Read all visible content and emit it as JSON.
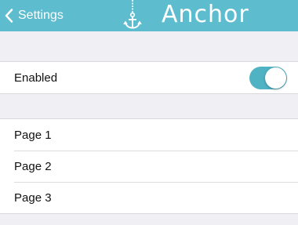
{
  "nav": {
    "back_label": "Settings",
    "title": "Anchor",
    "icons": {
      "back": "chevron-left-icon",
      "logo": "anchor-icon"
    },
    "colors": {
      "bar": "#5dbccd",
      "text": "#ffffff"
    }
  },
  "settings": {
    "enabled": {
      "label": "Enabled",
      "value": true,
      "accent": "#4fb3c4"
    },
    "pages": [
      {
        "label": "Page 1"
      },
      {
        "label": "Page 2"
      },
      {
        "label": "Page 3"
      }
    ]
  }
}
